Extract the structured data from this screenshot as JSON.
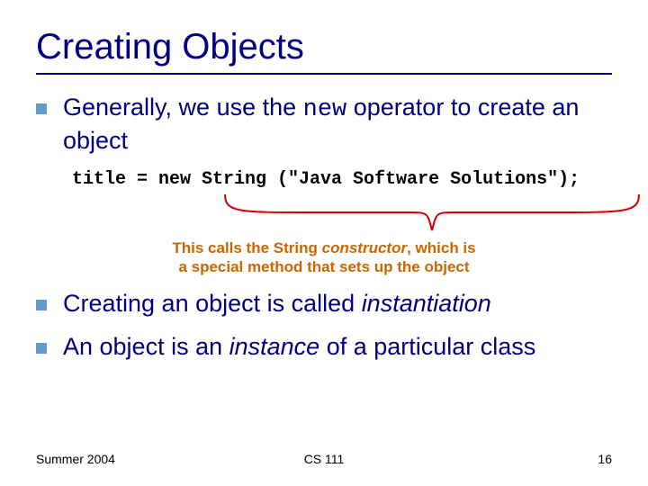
{
  "title": "Creating Objects",
  "bullets": {
    "b1_pre": "Generally, we use the ",
    "b1_mono": "new",
    "b1_post": " operator to create an object",
    "b2_pre": "Creating an object is called ",
    "b2_ital": "instantiation",
    "b3_pre": "An object is an ",
    "b3_ital": "instance",
    "b3_post": " of a particular class"
  },
  "code": "title = new String (\"Java Software Solutions\");",
  "callout": {
    "line1_pre": "This calls the String ",
    "line1_ital": "constructor",
    "line1_post": ", which is",
    "line2": "a special method that sets up the object"
  },
  "footer": {
    "left": "Summer 2004",
    "center": "CS 111",
    "right": "16"
  }
}
